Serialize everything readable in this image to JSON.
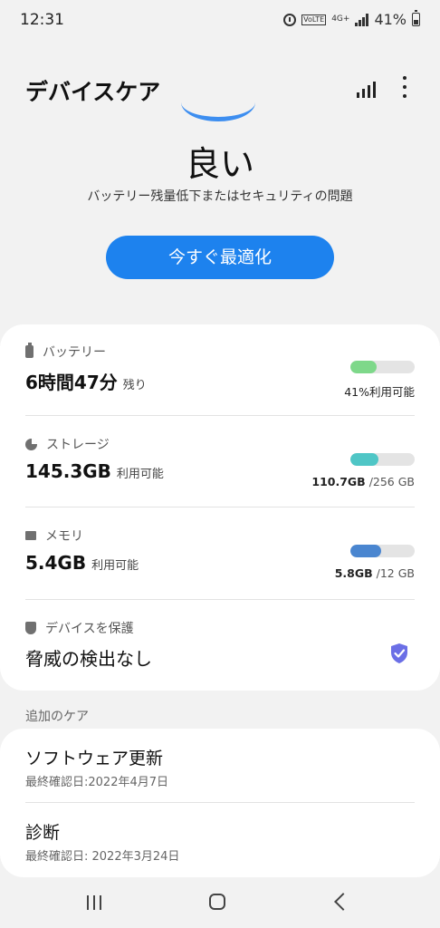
{
  "status": {
    "time": "12:31",
    "network": "4G+",
    "volte": "VoLTE",
    "battery": "41%"
  },
  "header": {
    "title": "デバイスケア"
  },
  "score": {
    "label": "良い",
    "subtitle": "バッテリー残量低下またはセキュリティの問題"
  },
  "optimize_label": "今すぐ最適化",
  "items": {
    "battery": {
      "title": "バッテリー",
      "value": "6時間47分",
      "suffix": "残り",
      "right_text": "41%利用可能",
      "level": 0.41,
      "color": "#7ed88a"
    },
    "storage": {
      "title": "ストレージ",
      "value": "145.3GB",
      "suffix": "利用可能",
      "used": "110.7GB",
      "total": "/256 GB",
      "level": 0.43,
      "color": "#4fc6c6"
    },
    "memory": {
      "title": "メモリ",
      "value": "5.4GB",
      "suffix": "利用可能",
      "used": "5.8GB",
      "total": "/12 GB",
      "level": 0.48,
      "color": "#4a86d0"
    },
    "security": {
      "title": "デバイスを保護",
      "value": "脅威の検出なし",
      "color": "#6b6fe6"
    }
  },
  "additional": {
    "title": "追加のケア",
    "items": [
      {
        "title": "ソフトウェア更新",
        "sub": "最終確認日:2022年4月7日"
      },
      {
        "title": "診断",
        "sub": "最終確認日: 2022年3月24日"
      }
    ]
  }
}
